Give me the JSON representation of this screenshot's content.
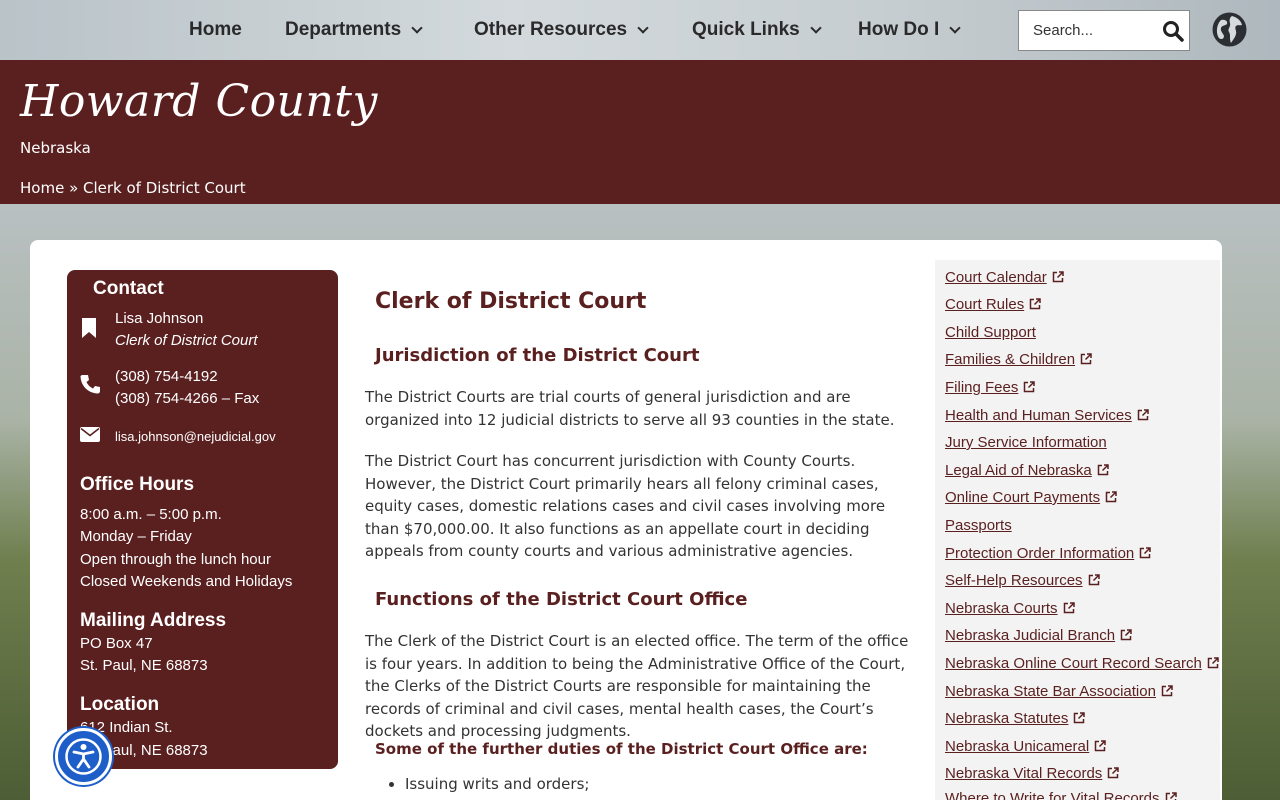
{
  "nav": {
    "items": [
      {
        "label": "Home"
      },
      {
        "label": "Departments"
      },
      {
        "label": "Other Resources"
      },
      {
        "label": "Quick Links"
      },
      {
        "label": "How Do I"
      }
    ],
    "search_placeholder": "Search..."
  },
  "header": {
    "title": "Howard County",
    "subtitle": "Nebraska",
    "breadcrumb": {
      "home": "Home",
      "sep": " » ",
      "current": "Clerk of District Court"
    }
  },
  "contact": {
    "heading": "Contact",
    "name": "Lisa Johnson",
    "role": "Clerk of District Court",
    "phone": "(308) 754-4192",
    "fax": "(308) 754-4266 – Fax",
    "email": "lisa.johnson@nejudicial.gov",
    "hours_heading": "Office Hours",
    "hours": [
      "8:00 a.m. – 5:00 p.m.",
      "Monday – Friday",
      "Open through the lunch hour",
      "Closed Weekends and Holidays"
    ],
    "mailing_heading": "Mailing Address",
    "mailing": [
      "PO Box 47",
      "St. Paul, NE 68873"
    ],
    "location_heading": "Location",
    "location": [
      "612 Indian St.",
      "St. Paul, NE 68873"
    ]
  },
  "main": {
    "title": "Clerk of District Court",
    "h_jurisdiction": "Jurisdiction of the District Court",
    "p1": "The District Courts are trial courts of general jurisdiction and are organized into 12 judicial districts to serve all 93 counties in the state.",
    "p2": "The District Court has concurrent jurisdiction with County Courts. However, the District Court primarily hears all felony criminal cases, equity cases, domestic relations cases and civil cases involving more than $70,000.00. It also functions as an appellate court in deciding appeals from county courts and various administrative agencies.",
    "h_functions": "Functions of the District Court Office",
    "p3": "The Clerk of the District Court is an elected office. The term of the office is four years.  In addition to being the Administrative Office of the Court, the Clerks of the District Courts are responsible for maintaining the records of criminal and civil cases, mental health cases, the Court’s dockets and processing judgments.",
    "duties_heading": "Some of the further duties of the District Court Office are:",
    "duties": [
      "Issuing writs and orders;"
    ]
  },
  "links": [
    {
      "label": "Court Calendar",
      "external": true
    },
    {
      "label": "Court Rules",
      "external": true
    },
    {
      "label": "Child Support",
      "external": false
    },
    {
      "label": "Families & Children",
      "external": true
    },
    {
      "label": "Filing Fees",
      "external": true
    },
    {
      "label": "Health and Human Services",
      "external": true
    },
    {
      "label": "Jury Service Information",
      "external": false
    },
    {
      "label": "Legal Aid of Nebraska",
      "external": true
    },
    {
      "label": "Online Court Payments",
      "external": true
    },
    {
      "label": "Passports",
      "external": false
    },
    {
      "label": "Protection Order Information",
      "external": true
    },
    {
      "label": "Self-Help Resources",
      "external": true
    },
    {
      "label": "Nebraska Courts",
      "external": true
    },
    {
      "label": "Nebraska Judicial Branch",
      "external": true
    },
    {
      "label": "Nebraska Online Court Record Search",
      "external": true
    },
    {
      "label": "Nebraska State Bar Association",
      "external": true
    },
    {
      "label": "Nebraska Statutes",
      "external": true
    },
    {
      "label": "Nebraska Unicameral",
      "external": true
    },
    {
      "label": "Nebraska Vital Records",
      "external": true
    },
    {
      "label": "Where to Write for Vital Records",
      "external": true
    }
  ],
  "icons": {
    "search": "search-icon",
    "globe": "globe-icon",
    "bookmark": "bookmark-icon",
    "phone": "phone-icon",
    "email": "envelope-icon",
    "external": "external-link-icon",
    "accessibility": "accessibility-icon"
  },
  "colors": {
    "brand": "#5a1f1f",
    "accessibility": "#1e5ec9"
  }
}
